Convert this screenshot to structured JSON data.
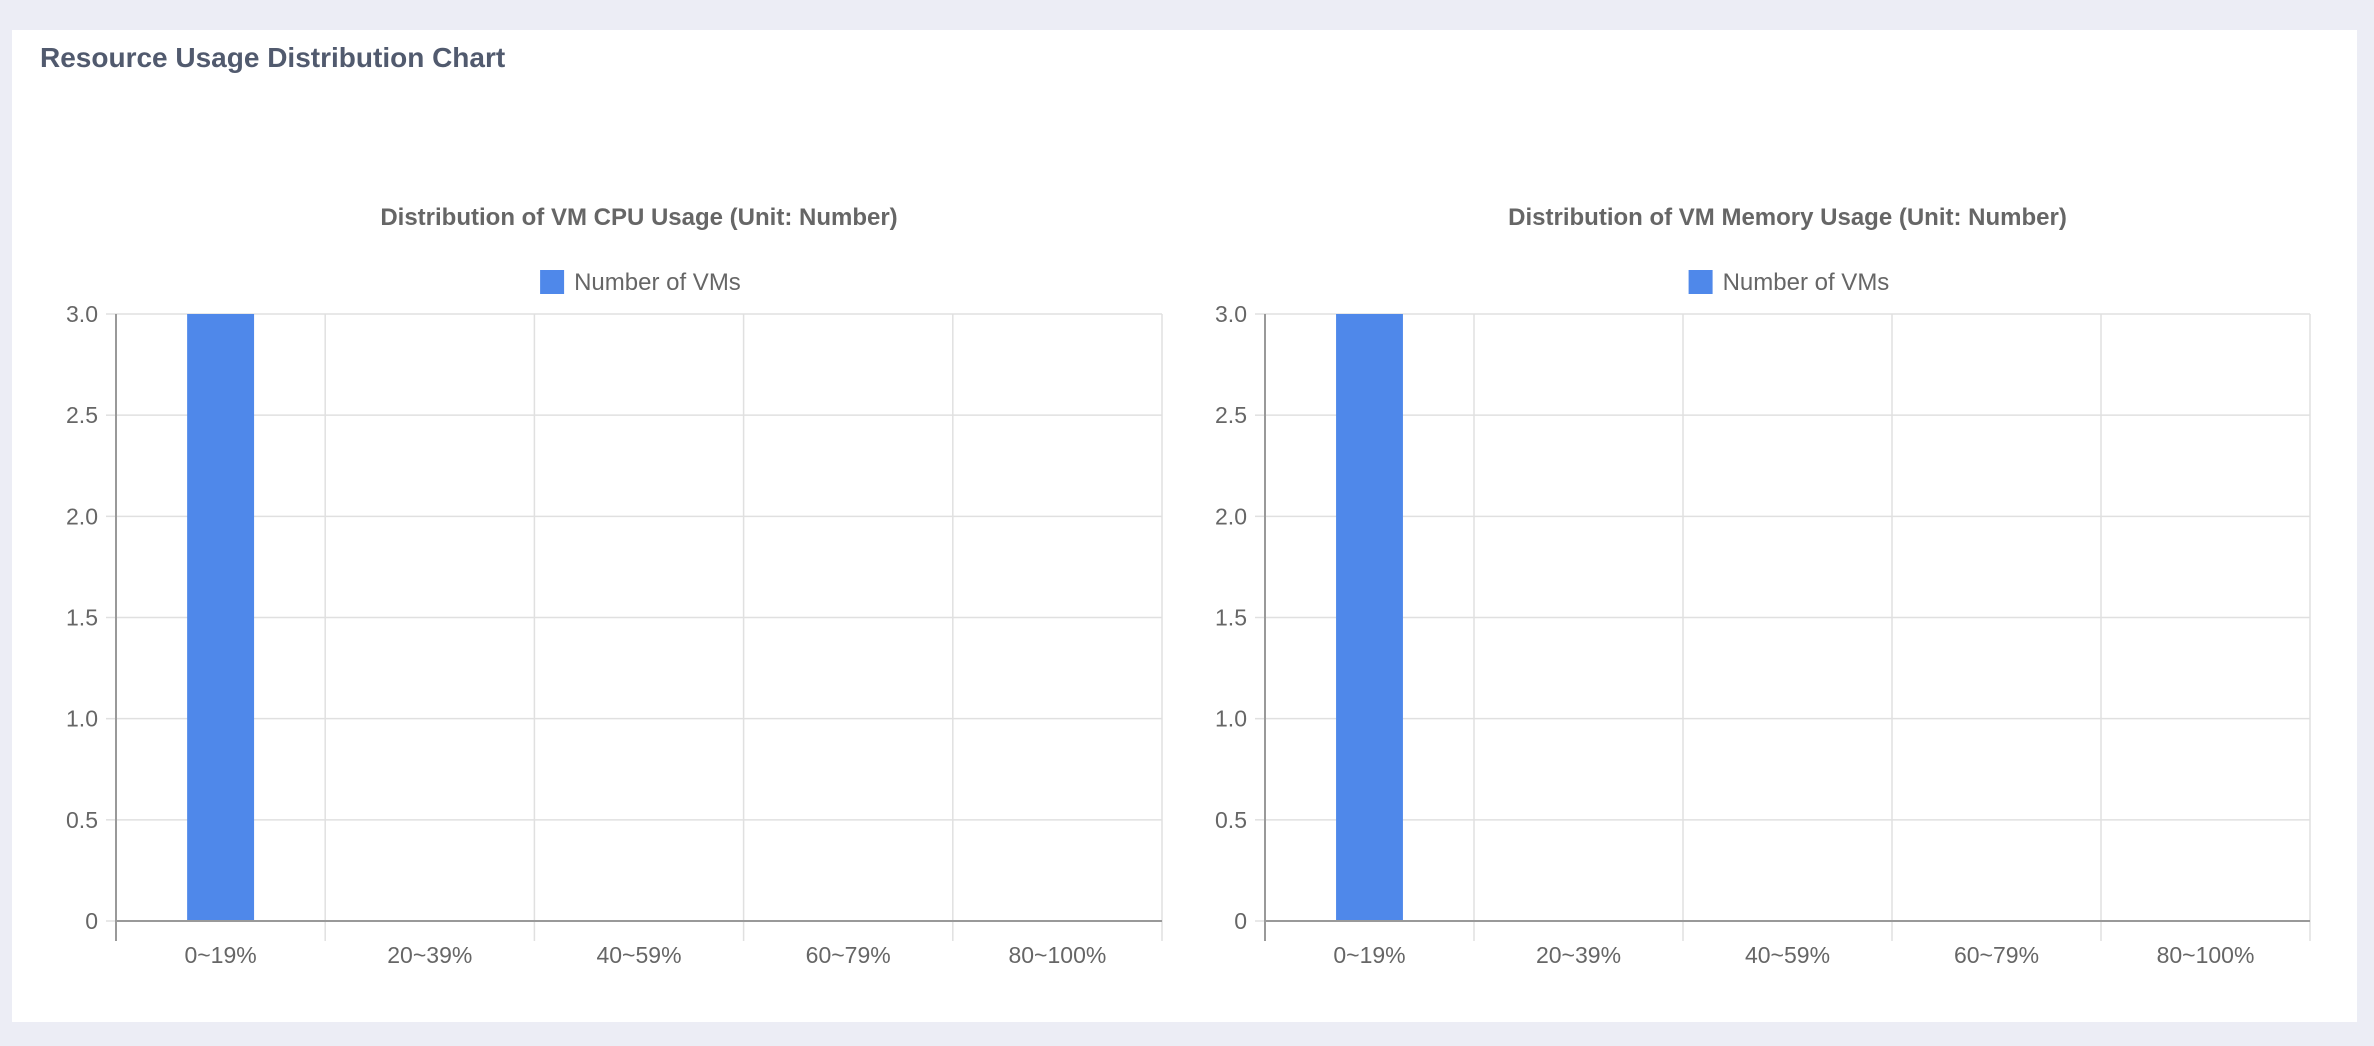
{
  "page": {
    "title": "Resource Usage Distribution Chart"
  },
  "colors": {
    "bar": "#4f88ea",
    "grid": "#e0e0e0",
    "axis": "#999999",
    "text": "#666666",
    "panel_title": "#515a6e",
    "background": "#ecedf5"
  },
  "chart_data": [
    {
      "type": "bar",
      "title": "Distribution of VM CPU Usage (Unit: Number)",
      "categories": [
        "0~19%",
        "20~39%",
        "40~59%",
        "60~79%",
        "80~100%"
      ],
      "series": [
        {
          "name": "Number of VMs",
          "values": [
            3,
            0,
            0,
            0,
            0
          ]
        }
      ],
      "xlabel": "",
      "ylabel": "",
      "ylim": [
        0,
        3.0
      ],
      "yticks": [
        "0",
        "0.5",
        "1.0",
        "1.5",
        "2.0",
        "2.5",
        "3.0"
      ],
      "grid": true,
      "legend": "top-center"
    },
    {
      "type": "bar",
      "title": "Distribution of VM Memory Usage (Unit: Number)",
      "categories": [
        "0~19%",
        "20~39%",
        "40~59%",
        "60~79%",
        "80~100%"
      ],
      "series": [
        {
          "name": "Number of VMs",
          "values": [
            3,
            0,
            0,
            0,
            0
          ]
        }
      ],
      "xlabel": "",
      "ylabel": "",
      "ylim": [
        0,
        3.0
      ],
      "yticks": [
        "0",
        "0.5",
        "1.0",
        "1.5",
        "2.0",
        "2.5",
        "3.0"
      ],
      "grid": true,
      "legend": "top-center"
    }
  ]
}
